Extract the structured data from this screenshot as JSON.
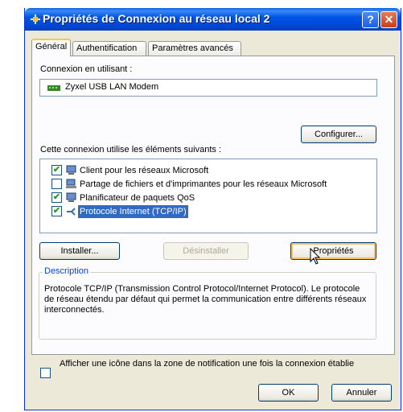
{
  "window": {
    "title": "Propriétés de Connexion au réseau local 2",
    "help_glyph": "?",
    "close_glyph": "✕"
  },
  "tabs": [
    {
      "label": "Général",
      "active": true
    },
    {
      "label": "Authentification",
      "active": false
    },
    {
      "label": "Paramètres avancés",
      "active": false
    }
  ],
  "general": {
    "connect_using_label": "Connexion en utilisant :",
    "adapter_name": "Zyxel USB LAN Modem",
    "configure_button": "Configurer...",
    "components_label": "Cette connexion utilise les éléments suivants :",
    "components": [
      {
        "label": "Client pour les réseaux Microsoft",
        "checked": true,
        "icon": "network-client-icon",
        "selected": false
      },
      {
        "label": "Partage de fichiers et d'imprimantes pour les réseaux Microsoft",
        "checked": false,
        "icon": "file-printer-sharing-icon",
        "selected": false
      },
      {
        "label": "Planificateur de paquets QoS",
        "checked": true,
        "icon": "qos-scheduler-icon",
        "selected": false
      },
      {
        "label": "Protocole Internet (TCP/IP)",
        "checked": true,
        "icon": "protocol-icon",
        "selected": true
      }
    ],
    "install_button": "Installer...",
    "uninstall_button": "Désinstaller",
    "properties_button": "Propriétés",
    "description_legend": "Description",
    "description_text": "Protocole TCP/IP (Transmission Control Protocol/Internet Protocol). Le protocole de réseau étendu par défaut qui permet la communication entre différents réseaux interconnectés.",
    "notify_checkbox_label": "Afficher une icône dans la zone de notification une fois la connexion établie",
    "notify_checked": false
  },
  "footer": {
    "ok_button": "OK",
    "cancel_button": "Annuler"
  },
  "colors": {
    "titlebar": "#0055e5",
    "dialog_bg": "#ece9d8",
    "selection": "#316ac5",
    "legend_text": "#0046d5"
  }
}
